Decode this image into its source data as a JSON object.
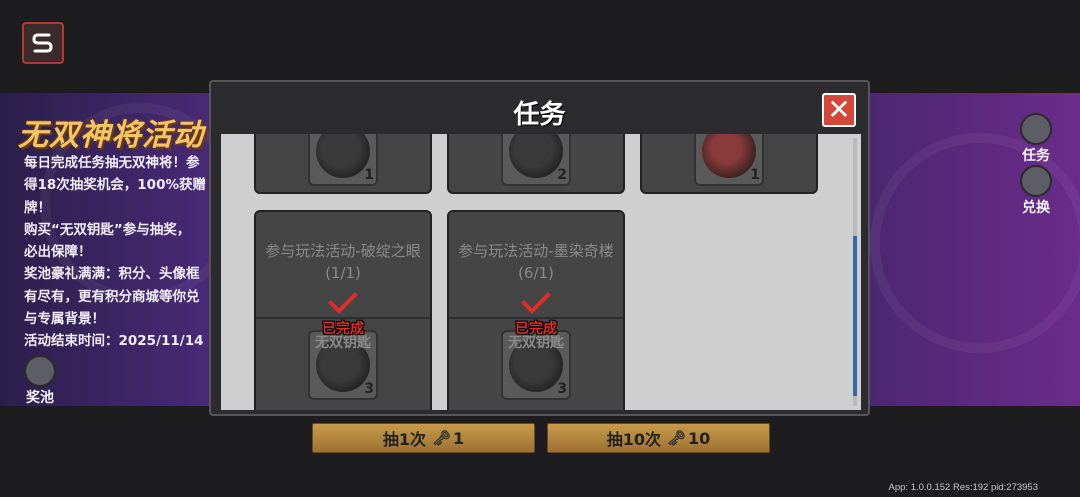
{
  "event": {
    "title": "无双神将活动",
    "description_lines": [
      "每日完成任务抽无双神将！参",
      "得18次抽奖机会，100%获赠",
      "牌！",
      "购买“无双钥匙”参与抽奖，",
      "必出保障！",
      "奖池豪礼满满：积分、头像框",
      "有尽有，更有积分商城等你兑",
      "与专属背景！",
      "活动结束时间：2025/11/14"
    ],
    "prize_pool_label": "奖池"
  },
  "side_menu": {
    "tasks_label": "任务",
    "exchange_label": "兑换"
  },
  "draw_buttons": {
    "draw_one_label": "抽1次",
    "draw_one_cost": "1",
    "draw_ten_label": "抽10次",
    "draw_ten_cost": "10"
  },
  "dialog": {
    "title": "任务",
    "close_glyph": "✕",
    "top_row_counts": [
      "1",
      "2",
      "1"
    ],
    "tasks": [
      {
        "name": "参与玩法活动-破绽之眼(1/1)",
        "status": "已完成",
        "reward_name": "无双钥匙",
        "reward_count": "3"
      },
      {
        "name": "参与玩法活动-墨染奇楼(6/1)",
        "status": "已完成",
        "reward_name": "无双钥匙",
        "reward_count": "3"
      }
    ]
  },
  "footer": {
    "version_text": "App: 1.0.0.152 Res:192 pid:273953"
  },
  "colors": {
    "accent_red": "#d5473a",
    "completed_red": "#e22b2b",
    "gold": "#f3c56a",
    "scroll_thumb": "#3a66a8"
  }
}
